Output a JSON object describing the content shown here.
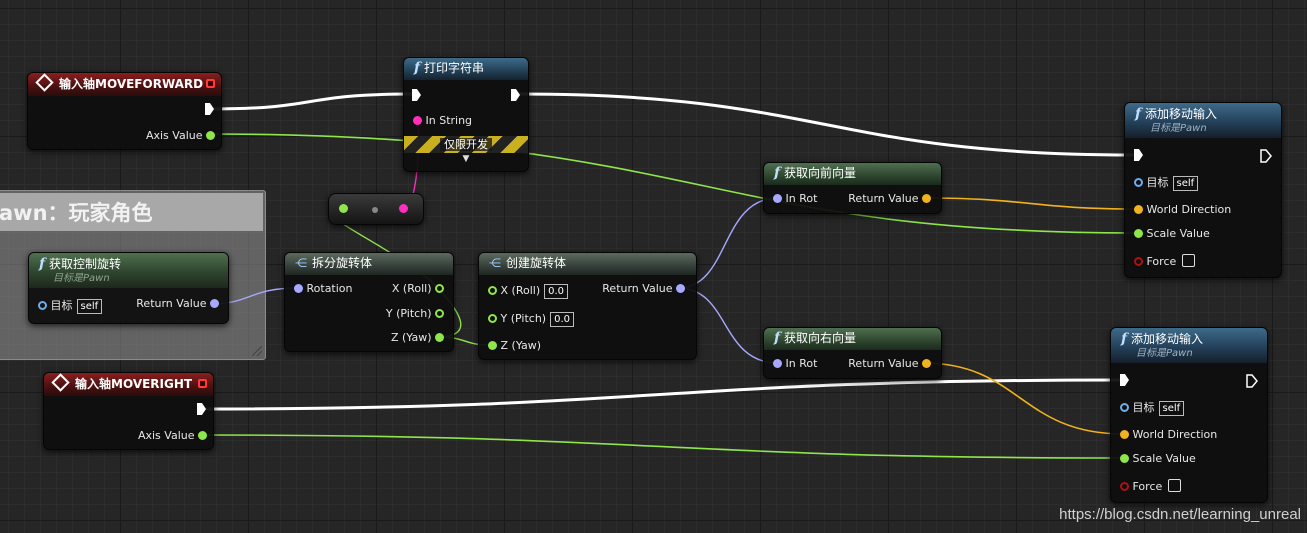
{
  "comment": {
    "title": "awn：玩家角色"
  },
  "nodes": {
    "moveforward": {
      "title": "输入轴MOVEFORWARD",
      "pin_axis": "Axis Value"
    },
    "moveright": {
      "title": "输入轴MOVERIGHT",
      "pin_axis": "Axis Value"
    },
    "printstring": {
      "title": "打印字符串",
      "pin_in": "In String",
      "dev_only": "仅限开发"
    },
    "getcontrolrot": {
      "title": "获取控制旋转",
      "subtitle": "目标是Pawn",
      "pin_target": "目标",
      "target_default": "self",
      "pin_return": "Return Value"
    },
    "breakrot": {
      "title": "拆分旋转体",
      "pin_in": "Rotation",
      "pin_x": "X (Roll)",
      "pin_y": "Y (Pitch)",
      "pin_z": "Z (Yaw)"
    },
    "makerot": {
      "title": "创建旋转体",
      "pin_x": "X (Roll)",
      "x_default": "0.0",
      "pin_y": "Y (Pitch)",
      "y_default": "0.0",
      "pin_z": "Z (Yaw)",
      "pin_return": "Return Value"
    },
    "getforward": {
      "title": "获取向前向量",
      "pin_in": "In Rot",
      "pin_return": "Return Value"
    },
    "getright": {
      "title": "获取向右向量",
      "pin_in": "In Rot",
      "pin_return": "Return Value"
    },
    "addmove1": {
      "title": "添加移动输入",
      "subtitle": "目标是Pawn",
      "pin_target": "目标",
      "target_default": "self",
      "pin_dir": "World Direction",
      "pin_scale": "Scale Value",
      "pin_force": "Force"
    },
    "addmove2": {
      "title": "添加移动输入",
      "subtitle": "目标是Pawn",
      "pin_target": "目标",
      "target_default": "self",
      "pin_dir": "World Direction",
      "pin_scale": "Scale Value",
      "pin_force": "Force"
    }
  },
  "icons": {
    "function": "function-icon",
    "event": "event-diamond-icon",
    "struct": "struct-icon"
  },
  "colors": {
    "exec": "#ffffff",
    "float": "#8ee64a",
    "vector": "#f0b21e",
    "rotator": "#a6a9ff",
    "string": "#ff2ebd",
    "object": "#6aaeea",
    "bool": "#b01010"
  },
  "watermark": "https://blog.csdn.net/learning_unreal"
}
